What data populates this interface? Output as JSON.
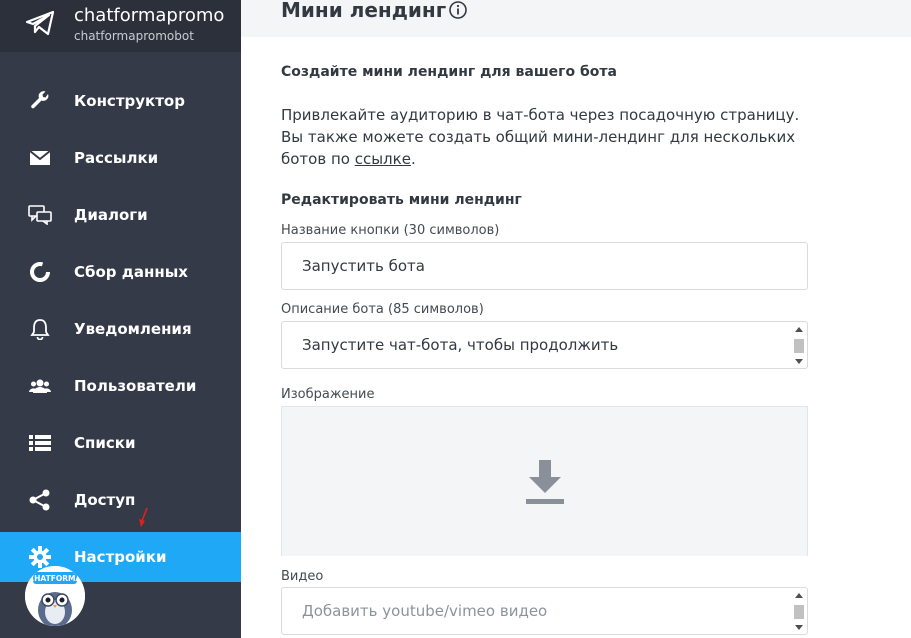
{
  "bot": {
    "name": "chatformapromo",
    "username": "chatformapromobot"
  },
  "sidebar": {
    "items": [
      {
        "label": "Конструктор",
        "icon": "wrench-icon"
      },
      {
        "label": "Рассылки",
        "icon": "envelope-icon"
      },
      {
        "label": "Диалоги",
        "icon": "chat-bubbles-icon"
      },
      {
        "label": "Сбор данных",
        "icon": "donut-chart-icon"
      },
      {
        "label": "Уведомления",
        "icon": "bell-icon"
      },
      {
        "label": "Пользователи",
        "icon": "users-icon"
      },
      {
        "label": "Списки",
        "icon": "list-icon"
      },
      {
        "label": "Доступ",
        "icon": "share-icon"
      },
      {
        "label": "Настройки",
        "icon": "gear-icon",
        "active": true
      }
    ],
    "avatar_badge": "CHATFORMA"
  },
  "page": {
    "title": "Мини лендинг",
    "create_heading": "Создайте мини лендинг для вашего бота",
    "description_line1": "Привлекайте аудиторию в чат-бота через посадочную страницу.",
    "description_line2": "Вы также можете создать общий мини-лендинг для нескольких",
    "description_line3_prefix": "ботов по ",
    "description_link": "ссылке",
    "description_line3_suffix": ".",
    "edit_heading": "Редактировать мини лендинг"
  },
  "form": {
    "button_name_label": "Название кнопки (30 символов)",
    "button_name_value": "Запустить бота",
    "bot_description_label": "Описание бота (85 символов)",
    "bot_description_value": "Запустите чат-бота, чтобы продолжить",
    "image_label": "Изображение",
    "video_label": "Видео",
    "video_placeholder": "Добавить youtube/vimeo видео"
  },
  "colors": {
    "sidebar_bg": "#343a48",
    "active_item": "#1ea8f5",
    "text": "#333942"
  }
}
